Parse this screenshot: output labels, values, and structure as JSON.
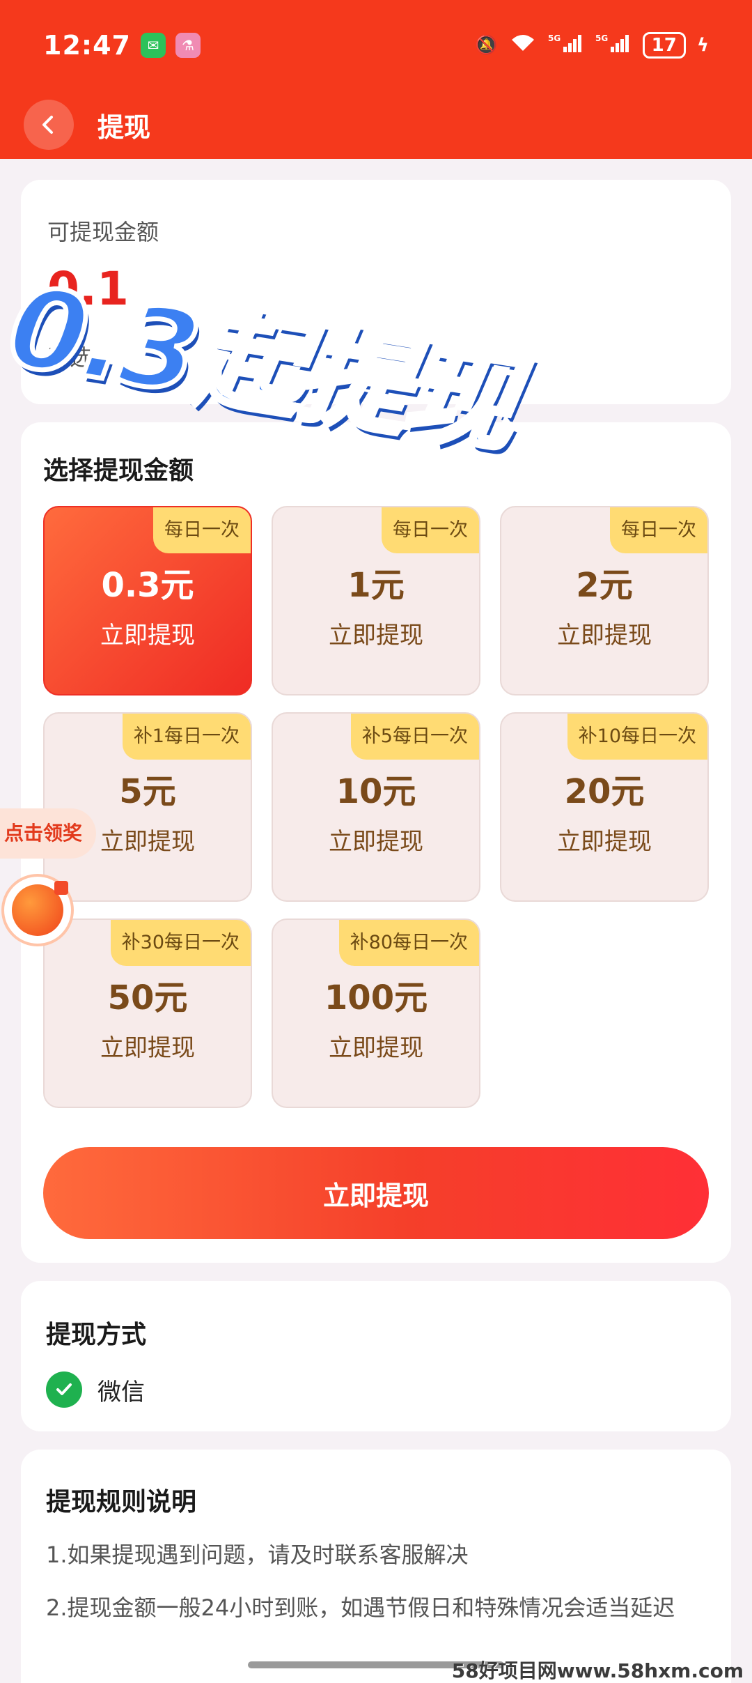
{
  "status_bar": {
    "time": "12:47",
    "apps": [
      "wechat-icon",
      "app-icon"
    ],
    "network": [
      "mute-icon",
      "wifi-icon",
      "5g-signal-icon",
      "5g-signal-icon"
    ],
    "battery": "17"
  },
  "header": {
    "title": "提现",
    "back_icon": "chevron-left-icon"
  },
  "balance": {
    "label": "可提现金额",
    "amount": "0.1",
    "sub_label": "已选"
  },
  "promo": {
    "text": "0.3起提现"
  },
  "select": {
    "title": "选择提现金额",
    "selected_index": 0,
    "options": [
      {
        "badge": "每日一次",
        "amount": "0.3元",
        "action": "立即提现"
      },
      {
        "badge": "每日一次",
        "amount": "1元",
        "action": "立即提现"
      },
      {
        "badge": "每日一次",
        "amount": "2元",
        "action": "立即提现"
      },
      {
        "badge": "补1每日一次",
        "amount": "5元",
        "action": "立即提现"
      },
      {
        "badge": "补5每日一次",
        "amount": "10元",
        "action": "立即提现"
      },
      {
        "badge": "补10每日一次",
        "amount": "20元",
        "action": "立即提现"
      },
      {
        "badge": "补30每日一次",
        "amount": "50元",
        "action": "立即提现"
      },
      {
        "badge": "补80每日一次",
        "amount": "100元",
        "action": "立即提现"
      }
    ],
    "button_label": "立即提现"
  },
  "method": {
    "title": "提现方式",
    "option_label": "微信",
    "selected": true
  },
  "rules": {
    "title": "提现规则说明",
    "items": [
      "1.如果提现遇到问题，请及时联系客服解决",
      "2.提现金额一般24小时到账，如遇节假日和特殊情况会适当延迟"
    ]
  },
  "float_widget": {
    "label": "点击领奖"
  },
  "watermark": "58好项目网www.58hxm.com",
  "colors": {
    "header": "#f5391c",
    "accent": "#ef2b24",
    "badge": "#ffdb73",
    "option_bg": "#f7ebea",
    "check": "#1fb14f",
    "promo_text": "#3c80f2"
  }
}
